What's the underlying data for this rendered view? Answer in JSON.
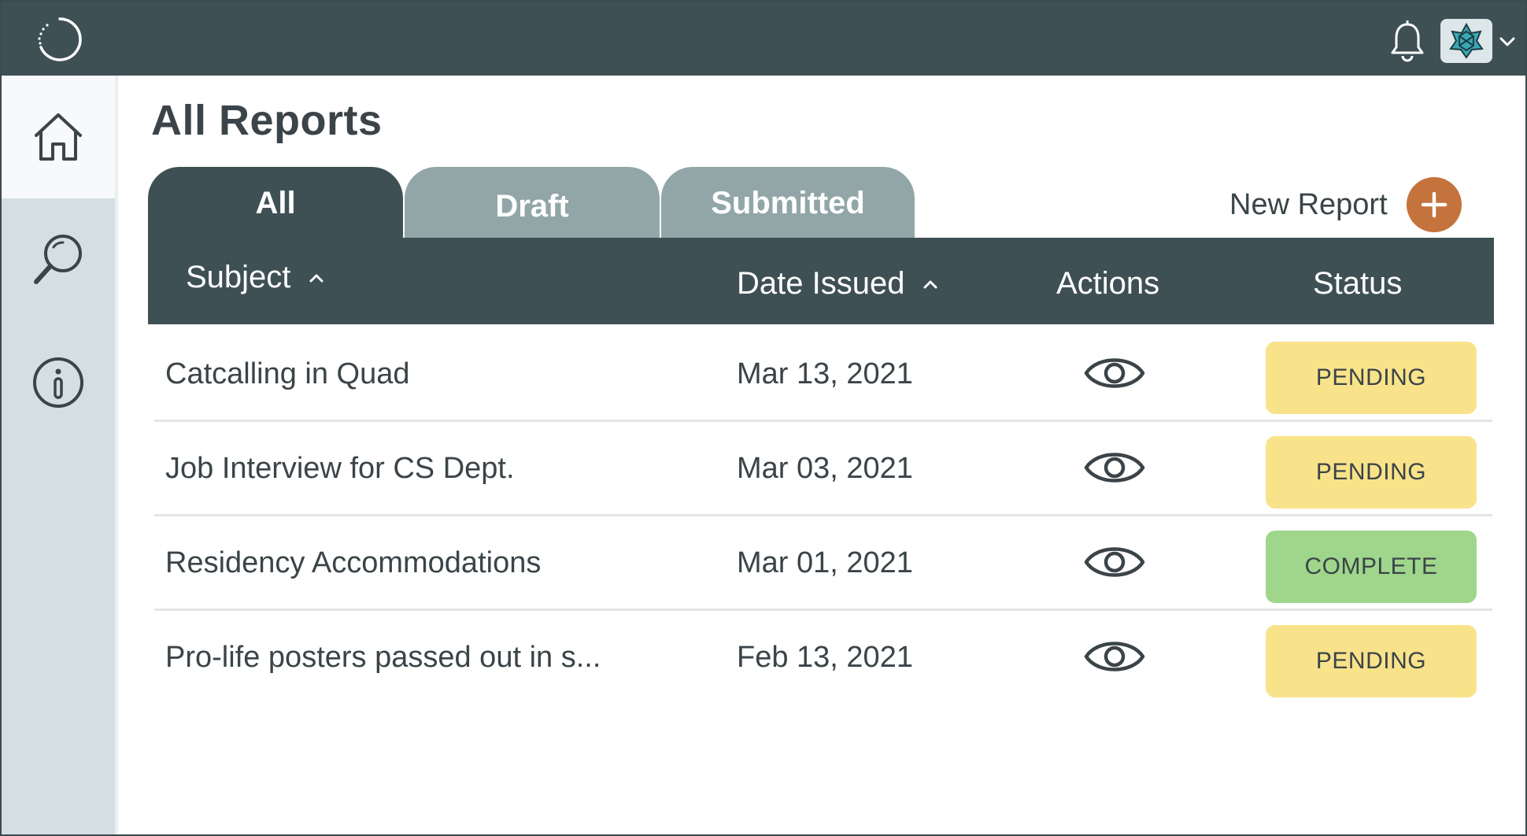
{
  "header": {
    "logo_icon": "circle-logo-icon",
    "bell_icon": "bell-icon",
    "avatar_icon": "avatar-icon",
    "dropdown_icon": "chevron-down-icon"
  },
  "sidebar": {
    "items": [
      {
        "name": "home",
        "icon": "home-icon",
        "active": true
      },
      {
        "name": "search",
        "icon": "search-icon",
        "active": false
      },
      {
        "name": "info",
        "icon": "info-icon",
        "active": false
      }
    ]
  },
  "page": {
    "title": "All Reports"
  },
  "tabs": [
    {
      "label": "All",
      "active": true
    },
    {
      "label": "Draft",
      "active": false
    },
    {
      "label": "Submitted",
      "active": false
    }
  ],
  "new_report": {
    "label": "New Report",
    "icon": "plus-icon"
  },
  "table": {
    "columns": {
      "subject": "Subject",
      "date": "Date Issued",
      "actions": "Actions",
      "status": "Status"
    },
    "rows": [
      {
        "subject": "Catcalling in Quad",
        "date": "Mar 13, 2021",
        "status": "PENDING"
      },
      {
        "subject": "Job Interview for CS Dept.",
        "date": "Mar 03, 2021",
        "status": "PENDING"
      },
      {
        "subject": "Residency Accommodations",
        "date": "Mar 01, 2021",
        "status": "COMPLETE"
      },
      {
        "subject": "Pro-life posters passed out in s...",
        "date": "Feb 13, 2021",
        "status": "PENDING"
      }
    ]
  },
  "colors": {
    "header_bg": "#3f5055",
    "tab_inactive": "#92a6a8",
    "sidebar_bg": "#d5dfe2",
    "accent": "#c4733d",
    "pending": "#f9e38a",
    "complete": "#9fd68c"
  }
}
